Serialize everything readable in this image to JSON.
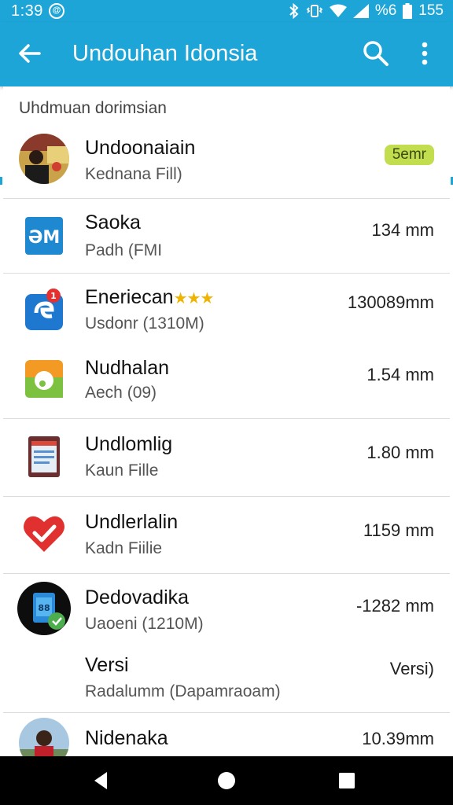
{
  "status_bar": {
    "time": "1:39",
    "circle_glyph": "@",
    "battery_percent": "%6",
    "signal_number": "155",
    "icons": [
      "bluetooth-icon",
      "vibrate-icon",
      "wifi-icon",
      "signal-icon",
      "battery-icon"
    ]
  },
  "app_bar": {
    "title": "Undouhan Idonsia",
    "icons": [
      "back-arrow-icon",
      "search-icon",
      "more-vert-icon"
    ]
  },
  "section_header": "Uhdmuan dorimsian",
  "colors": {
    "primary": "#1ea5d8",
    "badge": "#c2dd4e",
    "star": "#f0b400",
    "divider": "#dcdcdc"
  },
  "items": [
    {
      "name": "Undoonaiain",
      "sub": "Kednana Fill)",
      "badge": "5emr",
      "icon": "photo-avatar-icon"
    },
    {
      "name": "Saoka",
      "sub": "Padh (FMI",
      "size": "134 mm",
      "icon": "blue-m-app-icon"
    },
    {
      "name": "Eneriecan",
      "stars": "★★★",
      "sub": "Usdonr (1310M)",
      "size": "130089mm",
      "icon": "blue-notification-app-icon"
    },
    {
      "name": "Nudhalan",
      "sub": "Aech (09)",
      "size": "1.54 mm",
      "icon": "green-orange-app-icon"
    },
    {
      "name": "Undlomlig",
      "sub": "Kaun Fille",
      "size": "1.80 mm",
      "icon": "document-app-icon"
    },
    {
      "name": "Undlerlalin",
      "sub": "Kadn Fiilie",
      "size": "1159 mm",
      "icon": "heart-check-icon"
    },
    {
      "name": "Dedovadika",
      "sub": "Uaoeni (1210M)",
      "size": "-1282 mm",
      "icon": "phone-app-icon"
    },
    {
      "name": "Versi",
      "sub": "Radalumm (Dapamraoam)",
      "size": "Versi)"
    },
    {
      "name": "Nidenaka",
      "sub": "",
      "size": "10.39mm",
      "icon": "person-photo-icon"
    }
  ],
  "nav_bar": {
    "icons": [
      "nav-back-icon",
      "nav-home-icon",
      "nav-recents-icon"
    ]
  }
}
